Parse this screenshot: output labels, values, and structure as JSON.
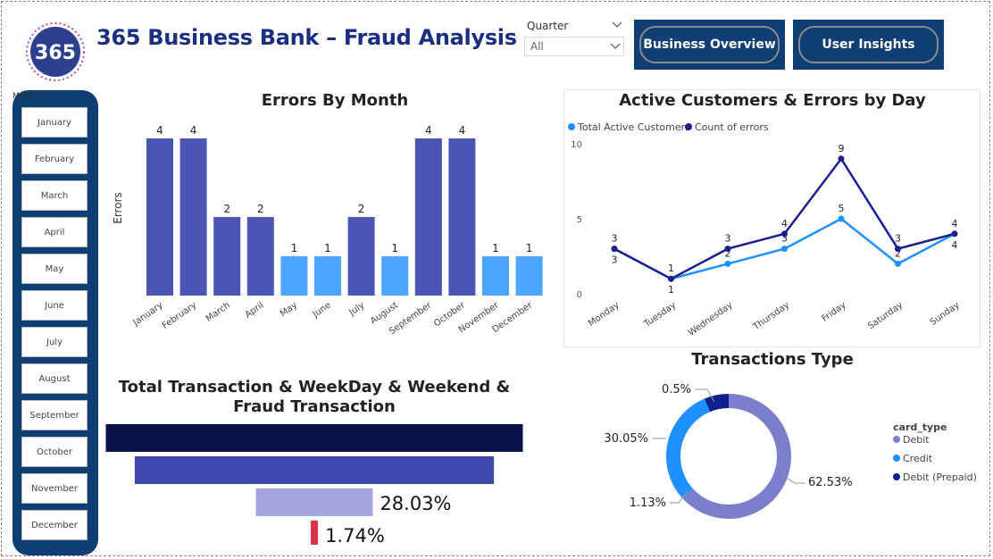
{
  "header": {
    "title": "365 Business Bank – Fraud  Analysis",
    "logo_text": "365"
  },
  "filter": {
    "label": "Quarter",
    "value": "All"
  },
  "nav": {
    "business_overview": "Business Overview",
    "user_insights": "User Insights"
  },
  "month_slicer": {
    "header": "Month",
    "items": [
      "January",
      "February",
      "March",
      "April",
      "May",
      "June",
      "July",
      "August",
      "September",
      "October",
      "November",
      "December"
    ]
  },
  "colors": {
    "navy": "#0e3e73",
    "bar_dark": "#4b55b5",
    "bar_light": "#4aa6ff",
    "line_light": "#1e90ff",
    "line_dark": "#1a1f8f",
    "funnel_1": "#0b124a",
    "funnel_2": "#3d48ad",
    "funnel_3": "#a2a6dc",
    "funnel_4": "#e0334a",
    "pie_debit": "#7a7fcc",
    "pie_credit": "#1e90ff",
    "pie_prepaid": "#0e1f8e"
  },
  "chart_data": [
    {
      "type": "bar",
      "title": "Errors By Month",
      "ylabel": "Errors",
      "xlabel": "",
      "categories": [
        "January",
        "February",
        "March",
        "April",
        "May",
        "June",
        "July",
        "August",
        "September",
        "October",
        "November",
        "December"
      ],
      "values": [
        4,
        4,
        2,
        2,
        1,
        1,
        2,
        1,
        4,
        4,
        1,
        1
      ],
      "ylim": [
        0,
        4
      ],
      "grid": false
    },
    {
      "type": "line",
      "title": "Active Customers & Errors by Day",
      "x": [
        "Monday",
        "Tuesday",
        "Wednesday",
        "Thursday",
        "Friday",
        "Saturday",
        "Sunday"
      ],
      "series": [
        {
          "name": "Total Active Customers",
          "values": [
            3,
            1,
            2,
            3,
            5,
            2,
            4
          ]
        },
        {
          "name": "Count of errors",
          "values": [
            3,
            1,
            3,
            4,
            9,
            3,
            4
          ]
        }
      ],
      "yticks": [
        0,
        5,
        10
      ],
      "ylim": [
        0,
        10
      ],
      "legend": "top-left"
    },
    {
      "type": "bar",
      "title": "Total Transaction & WeekDay & Weekend & Fraud Transaction",
      "values": [
        100,
        86.12,
        28.03,
        1.74
      ],
      "labels": [
        "",
        "",
        "28.03%",
        "1.74%"
      ]
    },
    {
      "type": "pie",
      "title": "Transactions Type",
      "legend_title": "card_type",
      "legend": "right",
      "slices": [
        {
          "name": "Debit",
          "value": 62.53,
          "label": "62.53%"
        },
        {
          "name": "Credit",
          "value": 30.05,
          "label": "30.05%"
        },
        {
          "name": "Debit (Prepaid)",
          "value": 6.29,
          "label": ""
        }
      ],
      "extra_labels": [
        "0.5%",
        "1.13%"
      ]
    }
  ]
}
